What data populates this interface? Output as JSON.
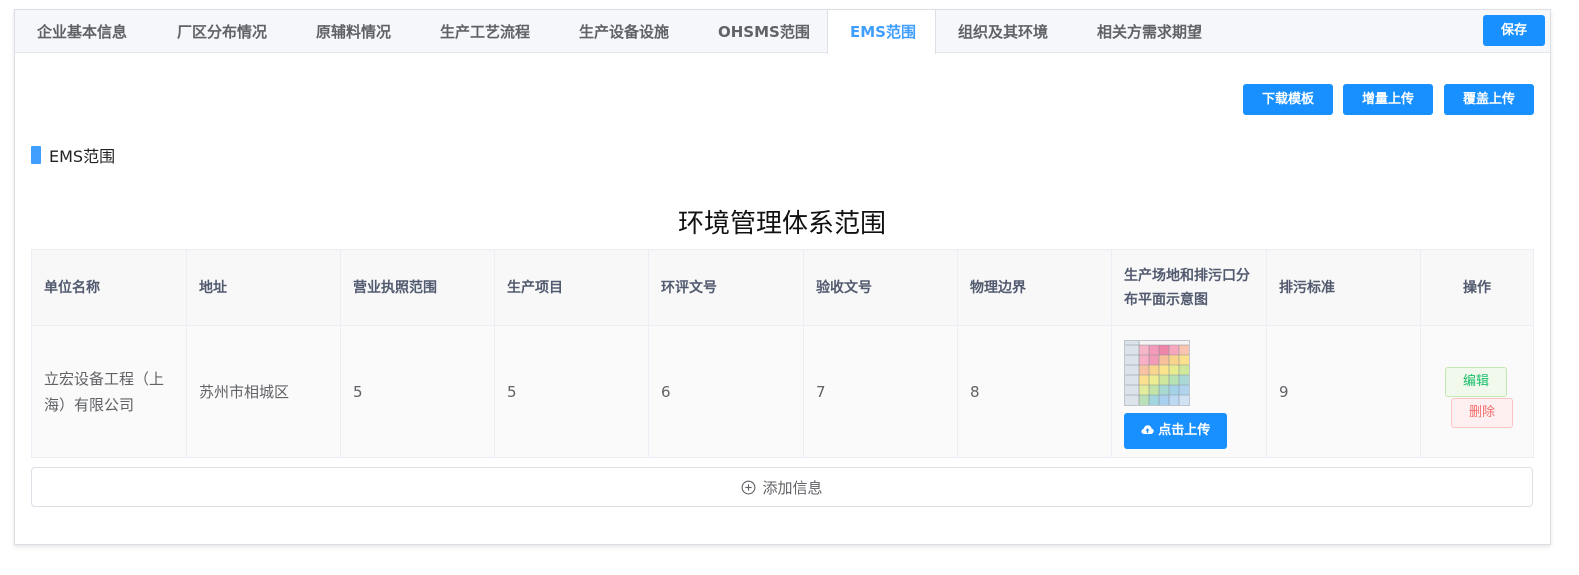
{
  "tabs": [
    {
      "label": "企业基本信息"
    },
    {
      "label": "厂区分布情况"
    },
    {
      "label": "原辅料情况"
    },
    {
      "label": "生产工艺流程"
    },
    {
      "label": "生产设备设施"
    },
    {
      "label": "OHSMS范围"
    },
    {
      "label": "EMS范围"
    },
    {
      "label": "组织及其环境"
    },
    {
      "label": "相关方需求期望"
    }
  ],
  "active_tab": "EMS范围",
  "save_label": "保存",
  "actions": {
    "download_template": "下载模板",
    "incremental_upload": "增量上传",
    "overwrite_upload": "覆盖上传"
  },
  "section": {
    "title": "EMS范围"
  },
  "table": {
    "title": "环境管理体系范围",
    "headers": [
      "单位名称",
      "地址",
      "营业执照范围",
      "生产项目",
      "环评文号",
      "验收文号",
      "物理边界",
      "生产场地和排污口分布平面示意图",
      "排污标准",
      "操作"
    ],
    "rows": [
      {
        "unit_name": "立宏设备工程（上海）有限公司",
        "address": "苏州市相城区",
        "license_scope": "5",
        "production_project": "5",
        "eia_no": "6",
        "acceptance_no": "7",
        "physical_boundary": "8",
        "upload_label": "点击上传",
        "emission_standard": "9",
        "edit_label": "编辑",
        "delete_label": "删除"
      }
    ]
  },
  "add_label": "添加信息",
  "colors": {
    "primary": "#1890ff",
    "tab_active": "#409eff",
    "success": "#19be6b",
    "danger": "#f56c6c"
  },
  "icons": {
    "upload": "cloud-upload-icon",
    "add": "plus-circle-icon"
  }
}
